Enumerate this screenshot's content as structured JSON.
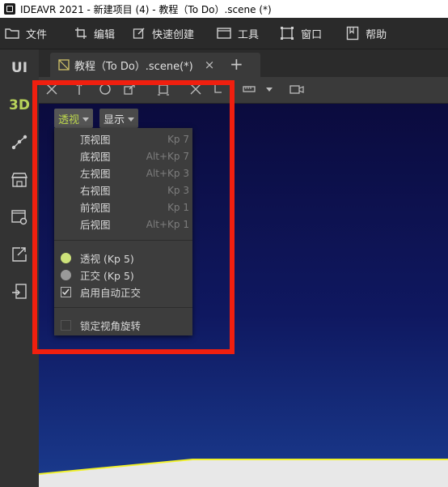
{
  "window": {
    "title": "IDEAVR 2021 - 新建项目 (4) - 教程（To Do）.scene (*)"
  },
  "menu": [
    {
      "label": "文件",
      "icon": "folder-icon"
    },
    {
      "label": "编辑",
      "icon": "crop-icon"
    },
    {
      "label": "快速创建",
      "icon": "edit-icon"
    },
    {
      "label": "工具",
      "icon": "window-icon"
    },
    {
      "label": "窗口",
      "icon": "frame-icon"
    },
    {
      "label": "帮助",
      "icon": "book-icon"
    }
  ],
  "sidebar": {
    "ui_label": "UI",
    "threed_label": "3D",
    "icons": [
      "graph-icon",
      "store-icon",
      "settings-window-icon",
      "export-icon",
      "exit-icon"
    ]
  },
  "tab": {
    "label": "教程（To Do）.scene(*)",
    "close": "×",
    "add": "+"
  },
  "viewport": {
    "view_button": "透视",
    "display_button": "显示"
  },
  "dropdown": {
    "views": [
      {
        "label": "顶视图",
        "key": "Kp 7"
      },
      {
        "label": "底视图",
        "key": "Alt+Kp 7"
      },
      {
        "label": "左视图",
        "key": "Alt+Kp 3"
      },
      {
        "label": "右视图",
        "key": "Kp 3"
      },
      {
        "label": "前视图",
        "key": "Kp 1"
      },
      {
        "label": "后视图",
        "key": "Alt+Kp 1"
      }
    ],
    "perspective": {
      "label": "透视 (Kp 5)",
      "selected": true
    },
    "orthogonal": {
      "label": "正交 (Kp 5)",
      "selected": false
    },
    "auto_ortho": {
      "label": "启用自动正交",
      "checked": true
    },
    "lock_rotation": {
      "label": "锁定视角旋转",
      "checked": false
    }
  },
  "colors": {
    "accent": "#bcd64c",
    "highlight": "#f01f0f"
  }
}
